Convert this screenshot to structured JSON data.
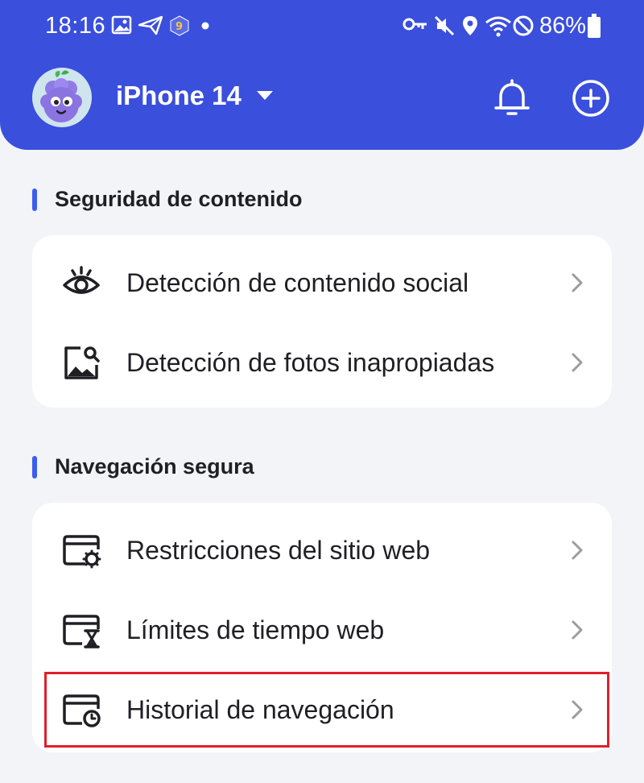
{
  "status_bar": {
    "time": "18:16",
    "battery": "86%",
    "icons": [
      "image-icon",
      "send-icon",
      "app-badge-icon",
      "dot-icon",
      "key-icon",
      "mute-icon",
      "location-icon",
      "wifi-icon",
      "do-not-disturb-icon",
      "battery-icon"
    ]
  },
  "header": {
    "device_name": "iPhone 14",
    "background": "#3a4fdc",
    "actions": [
      "bell-icon",
      "add-circle-icon"
    ]
  },
  "sections": [
    {
      "title": "Seguridad de contenido",
      "items": [
        {
          "label": "Detección de contenido social",
          "icon": "eye-icon"
        },
        {
          "label": "Detección de fotos inapropiadas",
          "icon": "photo-search-icon"
        }
      ]
    },
    {
      "title": "Navegación segura",
      "items": [
        {
          "label": "Restricciones del sitio web",
          "icon": "browser-settings-icon"
        },
        {
          "label": "Límites de tiempo web",
          "icon": "browser-hourglass-icon"
        },
        {
          "label": "Historial de navegación",
          "icon": "browser-history-icon",
          "highlighted": true
        }
      ]
    }
  ],
  "colors": {
    "accent": "#3a5df0",
    "highlight_border": "#e0202a",
    "page_background": "#f3f4f8"
  }
}
